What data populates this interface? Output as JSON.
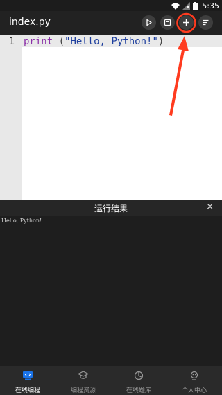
{
  "statusbar": {
    "time": "5:35"
  },
  "appbar": {
    "title": "index.py",
    "actions": [
      "play-icon",
      "save-icon",
      "plus-icon",
      "menu-icon"
    ]
  },
  "editor": {
    "line_number": "1",
    "code": {
      "keyword": "print",
      "open": " (",
      "string": "\"Hello, Python!\"",
      "close": ")"
    }
  },
  "result": {
    "title": "运行结果",
    "close": "×",
    "output": "Hello, Python!"
  },
  "nav": {
    "items": [
      {
        "label": "在线编程",
        "icon": "monitor-icon",
        "active": true
      },
      {
        "label": "编程资源",
        "icon": "graduation-cap-icon",
        "active": false
      },
      {
        "label": "在线题库",
        "icon": "pie-chart-icon",
        "active": false
      },
      {
        "label": "个人中心",
        "icon": "user-icon",
        "active": false
      }
    ]
  },
  "colors": {
    "accent": "#1a73e8",
    "annotation": "#ff3b1f",
    "keyword": "#8b2fa8",
    "string": "#1e3f9e"
  }
}
